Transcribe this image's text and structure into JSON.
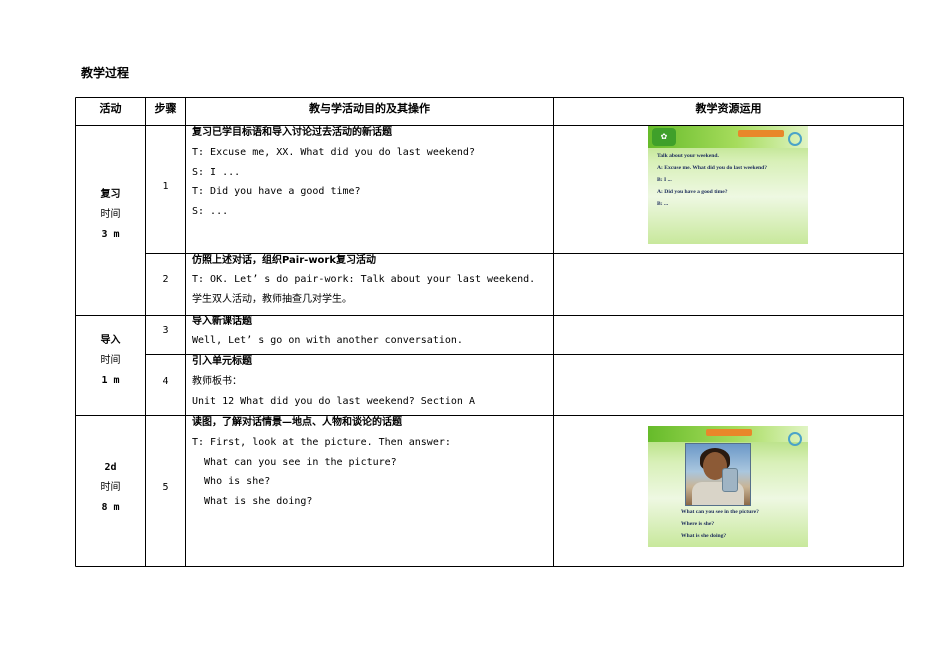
{
  "section_title": "教学过程",
  "table": {
    "headers": {
      "activity": "活动",
      "step": "步骤",
      "operation": "教与学活动目的及其操作",
      "resource": "教学资源运用"
    },
    "groups": [
      {
        "activity_name": "复习",
        "time_label": "时间",
        "time_value": "3 m",
        "steps": [
          {
            "number": "1",
            "title": "复习已学目标语和导入讨论过去活动的新话题",
            "lines": [
              "T: Excuse me, XX. What did you do last weekend?",
              "S: I ...",
              "T: Did you have a good time?",
              "S: ..."
            ]
          },
          {
            "number": "2",
            "title": "仿照上述对话，组织Pair-work复习活动",
            "lines": [
              "T: OK. Let’ s do pair-work: Talk about your last weekend.",
              "学生双人活动，教师抽查几对学生。"
            ]
          }
        ]
      },
      {
        "activity_name": "导入",
        "time_label": "时间",
        "time_value": "1 m",
        "steps": [
          {
            "number": "3",
            "title": "导入新课话题",
            "lines": [
              "Well, Let’ s go on with another conversation."
            ]
          },
          {
            "number": "4",
            "title": "引入单元标题",
            "lines": [
              "教师板书：",
              "Unit 12  What did you do last weekend?  Section A"
            ]
          }
        ]
      },
      {
        "activity_name": "2d",
        "time_label": "时间",
        "time_value": "8 m",
        "steps": [
          {
            "number": "5",
            "title": "读图，了解对话情景—地点、人物和谈论的话题",
            "lines": [
              "T: First, look at the picture. Then answer:",
              "  What can you see in the picture?",
              "  Who is she?",
              "  What is she doing?"
            ]
          }
        ]
      }
    ]
  },
  "slides": {
    "slide1": {
      "lines": [
        "Talk about your weekend.",
        "A:  Excuse me. What did you do last weekend?",
        "B:  I ...",
        "A:  Did you have a good time?",
        "B:  ..."
      ]
    },
    "slide2": {
      "lines": [
        "What can you see in the picture?",
        "Where is she?",
        "What is she doing?"
      ]
    }
  }
}
